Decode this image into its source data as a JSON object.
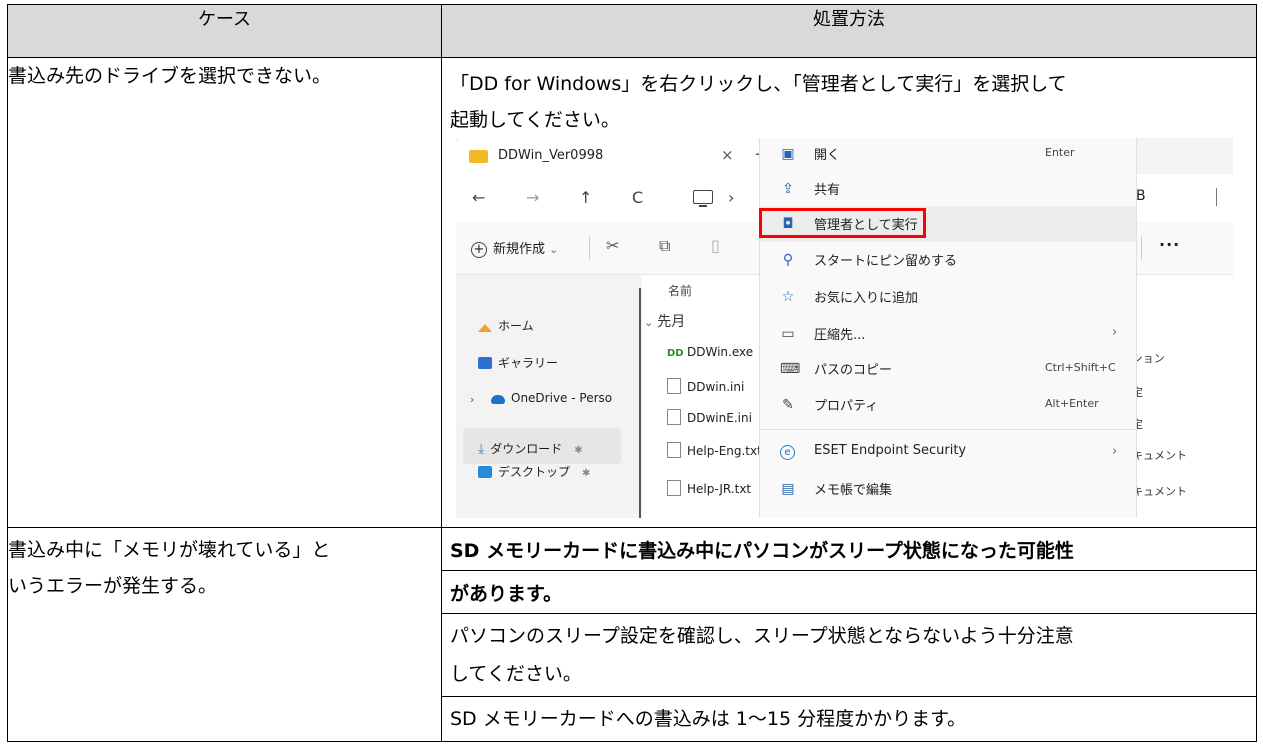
{
  "table": {
    "header_case": "ケース",
    "header_fix": "処置方法"
  },
  "row1": {
    "case": "書込み先のドライブを選択できない。",
    "fix_line1": "「DD for Windows」を右クリックし、「管理者として実行」を選択して",
    "fix_line2": "起動してください。"
  },
  "screenshot": {
    "tab_title": "DDWin_Ver0998",
    "tab_close": "×",
    "tab_plus": "+",
    "nav_back": "←",
    "nav_forward": "→",
    "nav_up": "↑",
    "nav_refresh": "C",
    "nav_chevron": "›",
    "nav_right_text": "B",
    "toolbar_new": "新規作成",
    "toolbar_new_chevron": "⌄",
    "toolbar_more": "···",
    "sidebar": {
      "home": "ホーム",
      "gallery": "ギャラリー",
      "onedrive": "OneDrive - Perso",
      "desktop": "デスクトップ",
      "downloads": "ダウンロード"
    },
    "column_name": "名前",
    "group_label": "先月",
    "files": [
      "DDWin.exe",
      "DDwin.ini",
      "DDwinE.ini",
      "Help-Eng.txt",
      "Help-JR.txt"
    ],
    "right_column": [
      "ーション",
      "設定",
      "設定",
      "ドキュメント",
      "ドキュメント"
    ],
    "menu": [
      {
        "label": "開く",
        "key": "Enter",
        "arrow": ""
      },
      {
        "label": "共有",
        "key": "",
        "arrow": ""
      },
      {
        "label": "管理者として実行",
        "key": "",
        "arrow": ""
      },
      {
        "label": "スタートにピン留めする",
        "key": "",
        "arrow": ""
      },
      {
        "label": "お気に入りに追加",
        "key": "",
        "arrow": ""
      },
      {
        "label": "圧縮先...",
        "key": "",
        "arrow": "›"
      },
      {
        "label": "パスのコピー",
        "key": "Ctrl+Shift+C",
        "arrow": ""
      },
      {
        "label": "プロパティ",
        "key": "Alt+Enter",
        "arrow": ""
      },
      {
        "label": "ESET Endpoint Security",
        "key": "",
        "arrow": "›"
      },
      {
        "label": "メモ帳で編集",
        "key": "",
        "arrow": ""
      }
    ]
  },
  "row2": {
    "case_line1": "書込み中に「メモリが壊れている」と",
    "case_line2": "いうエラーが発生する。",
    "bold_line1": "SD メモリーカードに書込み中にパソコンがスリープ状態になった可能性",
    "bold_line2": "があります。",
    "line3": "パソコンのスリープ設定を確認し、スリープ状態とならないよう十分注意",
    "line4": "してください。",
    "line5": "SD メモリーカードへの書込みは 1～15 分程度かかります。"
  }
}
